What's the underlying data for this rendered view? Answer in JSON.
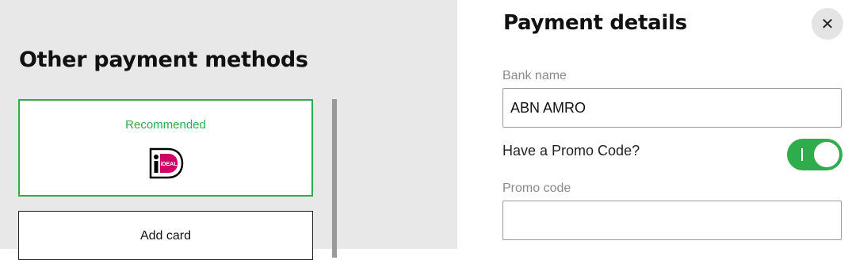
{
  "other_methods": {
    "title": "Other payment methods",
    "recommended_card": {
      "badge": "Recommended",
      "logo_icon": "ideal-logo-icon",
      "logo_text": "iDEAL"
    },
    "add_card": {
      "label": "Add card"
    }
  },
  "payment_details": {
    "title": "Payment details",
    "close_icon": "close-icon",
    "close_glyph": "✕",
    "bank": {
      "label": "Bank name",
      "value": "ABN AMRO"
    },
    "promo_toggle": {
      "label": "Have a Promo Code?",
      "on": true
    },
    "promo": {
      "label": "Promo code",
      "value": ""
    }
  },
  "colors": {
    "accent_green": "#2fac4c",
    "left_background": "#e8e8e8",
    "ideal_magenta": "#cc0066"
  }
}
